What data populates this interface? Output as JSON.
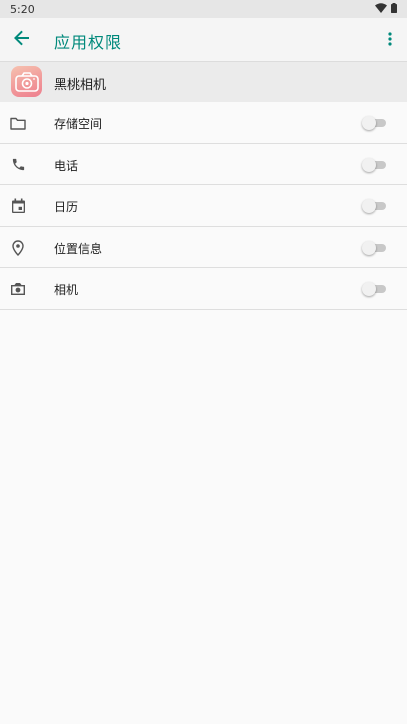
{
  "status_bar": {
    "time": "5:20",
    "wifi_icon": "wifi-icon",
    "battery_icon": "battery-icon"
  },
  "app_bar": {
    "back_icon": "arrow-back-icon",
    "title": "应用权限",
    "more_icon": "more-vert-icon"
  },
  "app_header": {
    "icon": "camera-app-icon",
    "name": "黑桃相机"
  },
  "colors": {
    "accent": "#00897b",
    "header_bg": "#ebebeb",
    "page_bg": "#fafafa"
  },
  "permissions": [
    {
      "label": "存储空间",
      "icon": "folder-icon",
      "enabled": false
    },
    {
      "label": "电话",
      "icon": "phone-icon",
      "enabled": false
    },
    {
      "label": "日历",
      "icon": "calendar-icon",
      "enabled": false
    },
    {
      "label": "位置信息",
      "icon": "location-icon",
      "enabled": false
    },
    {
      "label": "相机",
      "icon": "camera-icon",
      "enabled": false
    }
  ]
}
